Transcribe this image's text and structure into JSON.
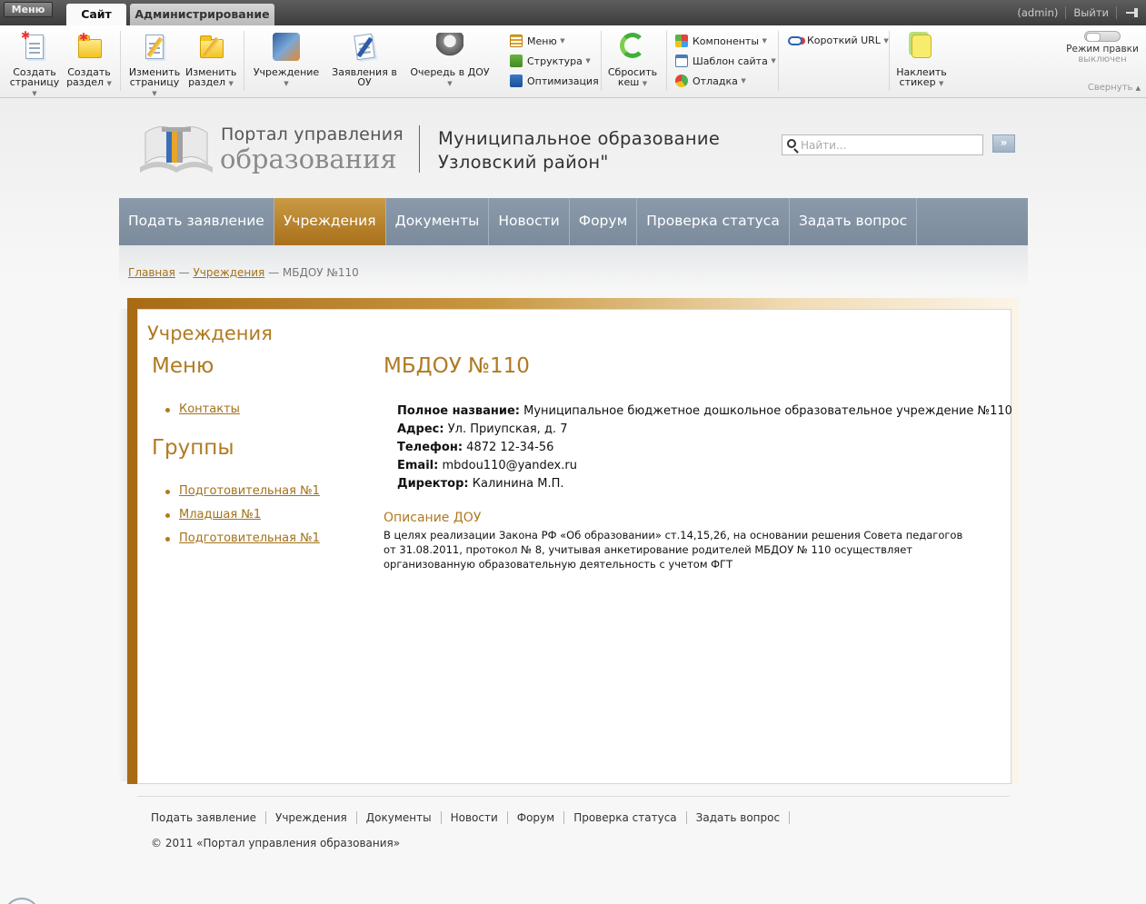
{
  "admin_bar": {
    "menu_label": "Меню",
    "tabs": [
      {
        "label": "Сайт",
        "active": true
      },
      {
        "label": "Администрирование",
        "active": false
      }
    ],
    "user": "(admin)",
    "logout": "Выйти"
  },
  "toolbar": {
    "create_page": [
      "Создать",
      "страницу"
    ],
    "create_section": [
      "Создать",
      "раздел"
    ],
    "edit_page": [
      "Изменить",
      "страницу"
    ],
    "edit_section": [
      "Изменить",
      "раздел"
    ],
    "institution": "Учреждение",
    "applications": "Заявления в ОУ",
    "queue": "Очередь в ДОУ",
    "menu": "Меню",
    "structure": "Структура",
    "optimization": "Оптимизация",
    "clear_cache": [
      "Сбросить",
      "кеш"
    ],
    "components": "Компоненты",
    "template": "Шаблон сайта",
    "debug": "Отладка",
    "short_url": "Короткий URL",
    "sticker": [
      "Наклеить",
      "стикер"
    ],
    "edit_mode": "Режим правки",
    "edit_mode_state": "выключен",
    "collapse": "Свернуть"
  },
  "header": {
    "logo_line1": "Портал управления",
    "logo_line2": "образования",
    "municipality_line1": "Муниципальное образование",
    "municipality_line2": "Узловский район\"",
    "search_placeholder": "Найти...",
    "search_button": "»"
  },
  "nav": [
    {
      "label": "Подать заявление",
      "active": false
    },
    {
      "label": "Учреждения",
      "active": true
    },
    {
      "label": "Документы",
      "active": false
    },
    {
      "label": "Новости",
      "active": false
    },
    {
      "label": "Форум",
      "active": false
    },
    {
      "label": "Проверка статуса",
      "active": false
    },
    {
      "label": "Задать вопрос",
      "active": false
    }
  ],
  "breadcrumb": {
    "home": "Главная",
    "sep": " — ",
    "section": "Учреждения",
    "current": "МБДОУ №110"
  },
  "sidebar": {
    "section_title": "Учреждения",
    "menu_title": "Меню",
    "menu_items": [
      "Контакты"
    ],
    "groups_title": "Группы",
    "groups": [
      "Подготовительная №1",
      "Младшая №1",
      "Подготовительная №1"
    ]
  },
  "institution": {
    "title": "МБДОУ №110",
    "fields": [
      {
        "label": "Полное название:",
        "value": " Муниципальное бюджетное дошкольное образовательное учреждение №110"
      },
      {
        "label": "Адрес:",
        "value": " Ул. Приупская, д. 7"
      },
      {
        "label": "Телефон:",
        "value": " 4872 12-34-56"
      },
      {
        "label": "Email:",
        "value": " mbdou110@yandex.ru"
      },
      {
        "label": "Директор:",
        "value": " Калинина М.П."
      }
    ],
    "description_title": "Описание ДОУ",
    "description": "В целях реализации Закона РФ «Об образовании» ст.14,15,26, на основании решения Совета педагогов от 31.08.2011, протокол № 8, учитывая анкетирование родителей МБДОУ № 110 осуществляет организованную образовательную деятельность с учетом ФГТ"
  },
  "footer": {
    "nav": [
      "Подать заявление",
      "Учреждения",
      "Документы",
      "Новости",
      "Форум",
      "Проверка статуса",
      "Задать вопрос"
    ],
    "copyright": "© 2011 «Портал управления образования»"
  },
  "colors": {
    "accent_gold": "#b07a22",
    "nav_bg": "#8596a8",
    "nav_active": "#b8832c"
  }
}
